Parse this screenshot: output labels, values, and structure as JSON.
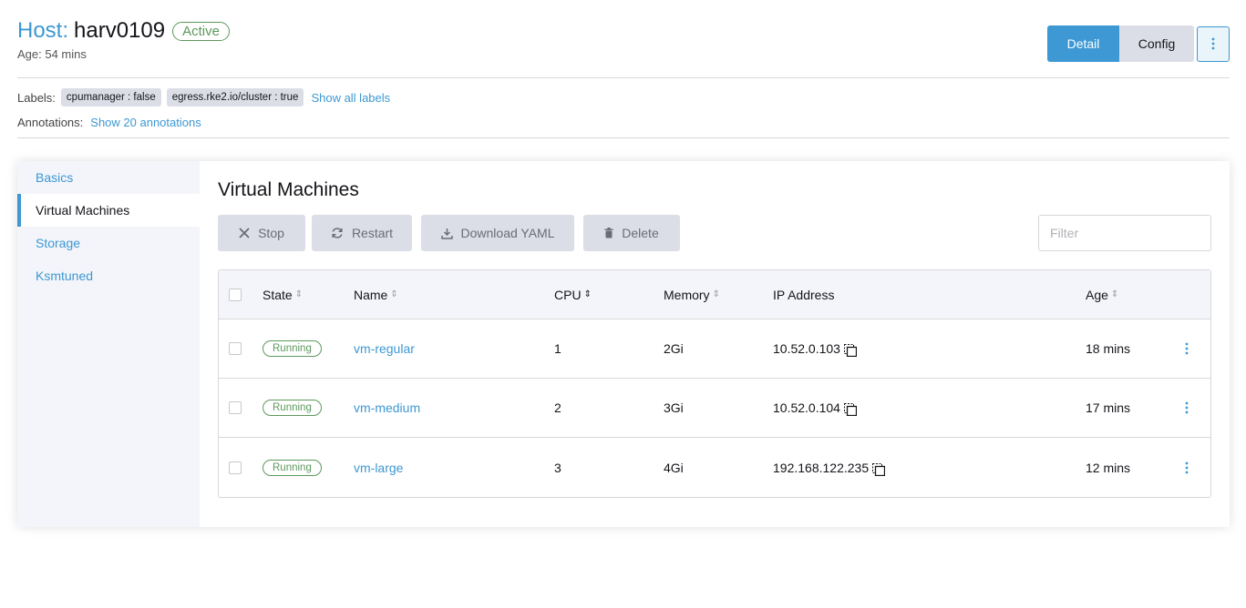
{
  "header": {
    "title_prefix": "Host:",
    "title_name": "harv0109",
    "state": "Active",
    "age": "Age: 54 mins",
    "detail_label": "Detail",
    "config_label": "Config",
    "menu_icon": "kebab-icon"
  },
  "meta": {
    "labels_key": "Labels:",
    "labels": [
      "cpumanager : false",
      "egress.rke2.io/cluster : true"
    ],
    "show_labels": "Show all labels",
    "annotations_key": "Annotations:",
    "show_annotations": "Show 20 annotations"
  },
  "sidebar": {
    "items": [
      {
        "label": "Basics",
        "active": false
      },
      {
        "label": "Virtual Machines",
        "active": true
      },
      {
        "label": "Storage",
        "active": false
      },
      {
        "label": "Ksmtuned",
        "active": false
      }
    ]
  },
  "main": {
    "title": "Virtual Machines",
    "actions": {
      "stop": "Stop",
      "restart": "Restart",
      "download_yaml": "Download YAML",
      "delete": "Delete"
    },
    "filter_placeholder": "Filter"
  },
  "table": {
    "columns": {
      "state": "State",
      "name": "Name",
      "cpu": "CPU",
      "memory": "Memory",
      "ip": "IP Address",
      "age": "Age"
    },
    "sorted_column": "cpu",
    "rows": [
      {
        "state": "Running",
        "name": "vm-regular",
        "cpu": "1",
        "memory": "2Gi",
        "ip": "10.52.0.103",
        "age": "18 mins"
      },
      {
        "state": "Running",
        "name": "vm-medium",
        "cpu": "2",
        "memory": "3Gi",
        "ip": "10.52.0.104",
        "age": "17 mins"
      },
      {
        "state": "Running",
        "name": "vm-large",
        "cpu": "3",
        "memory": "4Gi",
        "ip": "192.168.122.235",
        "age": "12 mins"
      }
    ]
  },
  "colors": {
    "accent": "#3d98d3",
    "success": "#5d995d",
    "muted_bg": "#dcdee7"
  }
}
